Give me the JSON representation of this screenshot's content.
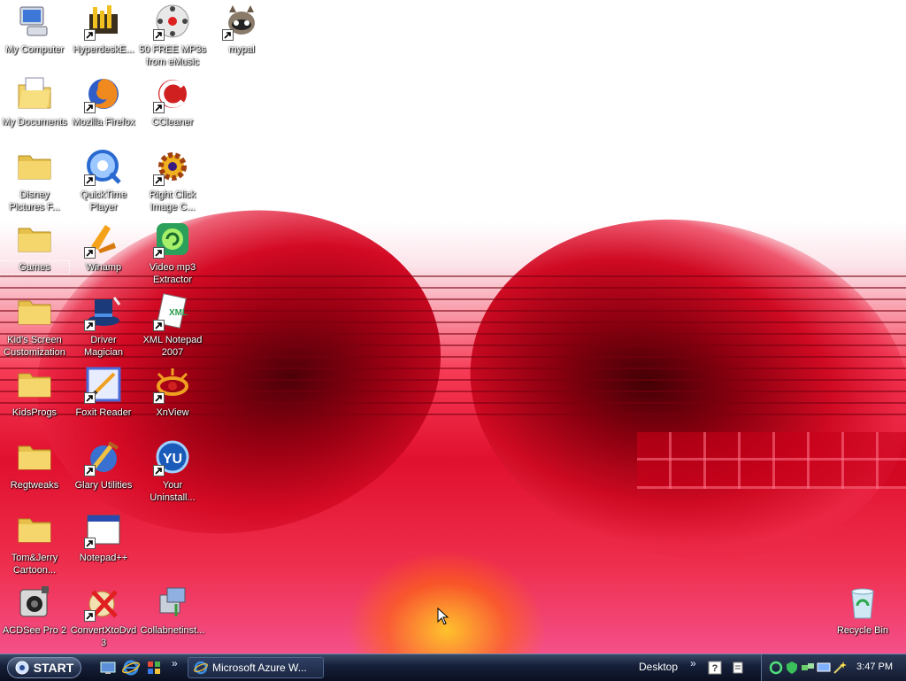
{
  "desktop": {
    "icons": [
      {
        "label": "My Computer",
        "icon": "my-computer-icon",
        "shortcut": false
      },
      {
        "label": "HyperdeskE...",
        "icon": "hyperdesk-icon",
        "shortcut": true
      },
      {
        "label": "50 FREE MP3s from eMusic",
        "icon": "emusic-icon",
        "shortcut": true
      },
      {
        "label": "mypal",
        "icon": "mypal-icon",
        "shortcut": true
      },
      {
        "label": "My Documents",
        "icon": "my-documents-icon",
        "shortcut": false
      },
      {
        "label": "Mozilla Firefox",
        "icon": "firefox-icon",
        "shortcut": true
      },
      {
        "label": "CCleaner",
        "icon": "ccleaner-icon",
        "shortcut": true
      },
      {
        "label": "Disney Pictures F...",
        "icon": "folder-icon",
        "shortcut": false
      },
      {
        "label": "QuickTime Player",
        "icon": "quicktime-icon",
        "shortcut": true
      },
      {
        "label": "Right Click Image C...",
        "icon": "gear-icon",
        "shortcut": true
      },
      {
        "label": "Games",
        "icon": "folder-icon",
        "shortcut": false
      },
      {
        "label": "Winamp",
        "icon": "winamp-icon",
        "shortcut": true
      },
      {
        "label": "Video mp3 Extractor",
        "icon": "video-mp3-icon",
        "shortcut": true
      },
      {
        "label": "Kid's Screen Customization",
        "icon": "folder-icon",
        "shortcut": false
      },
      {
        "label": "Driver Magician",
        "icon": "magician-hat-icon",
        "shortcut": true
      },
      {
        "label": "XML Notepad 2007",
        "icon": "xml-notepad-icon",
        "shortcut": true
      },
      {
        "label": "KidsProgs",
        "icon": "folder-icon",
        "shortcut": false
      },
      {
        "label": "Foxit Reader",
        "icon": "foxit-icon",
        "shortcut": true
      },
      {
        "label": "XnView",
        "icon": "xnview-icon",
        "shortcut": true
      },
      {
        "label": "Regtweaks",
        "icon": "folder-icon",
        "shortcut": false
      },
      {
        "label": "Glary Utilities",
        "icon": "glary-icon",
        "shortcut": true
      },
      {
        "label": "Your Uninstall...",
        "icon": "uninstaller-icon",
        "shortcut": true
      },
      {
        "label": "Tom&Jerry Cartoon...",
        "icon": "folder-icon",
        "shortcut": false
      },
      {
        "label": "Notepad++",
        "icon": "window-icon",
        "shortcut": true
      },
      {
        "label": "ACDSee Pro 2",
        "icon": "acdsee-icon",
        "shortcut": false
      },
      {
        "label": "ConvertXtoDvd 3",
        "icon": "convertx-icon",
        "shortcut": true
      },
      {
        "label": "Collabnetinst...",
        "icon": "installer-icon",
        "shortcut": false
      },
      {
        "label": "Recycle Bin",
        "icon": "recycle-bin-icon",
        "shortcut": false
      }
    ]
  },
  "taskbar": {
    "start_label": "START",
    "task_label": "Microsoft Azure W...",
    "toolbar_label": "Desktop",
    "chevron": "»",
    "clock": "3:47 PM"
  }
}
